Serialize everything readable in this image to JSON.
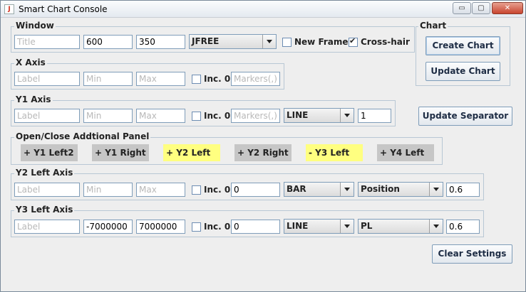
{
  "app": {
    "title": "Smart Chart Console"
  },
  "window_controls": {
    "minimize": "▭",
    "maximize": "▢",
    "close": "✕"
  },
  "window_group": {
    "label": "Window",
    "title": {
      "value": "",
      "placeholder": "Title"
    },
    "width": "600",
    "height": "350",
    "renderer": "JFREE",
    "new_frame": {
      "label": "New Frame",
      "checked": false
    },
    "crosshair": {
      "label": "Cross-hair",
      "checked": true
    }
  },
  "chart_group": {
    "label": "Chart",
    "create_label": "Create Chart",
    "update_label": "Update Chart"
  },
  "x_axis": {
    "label": "X Axis",
    "axis_label_placeholder": "Label",
    "min_placeholder": "Min",
    "max_placeholder": "Max",
    "inc0_label": "Inc. 0",
    "markers_placeholder": "Markers(,)"
  },
  "y1_axis": {
    "label": "Y1 Axis",
    "axis_label_placeholder": "Label",
    "min_placeholder": "Min",
    "max_placeholder": "Max",
    "inc0_label": "Inc. 0",
    "markers_placeholder": "Markers(,)",
    "type": "LINE",
    "value": "1"
  },
  "update_separator_label": "Update Separator",
  "panel_group": {
    "label": "Open/Close Addtional Panel",
    "buttons": [
      {
        "label": "+ Y1 Left2"
      },
      {
        "label": "+ Y1 Right"
      },
      {
        "label": "+ Y2 Left"
      },
      {
        "label": "+ Y2 Right"
      },
      {
        "label": "- Y3 Left"
      },
      {
        "label": "+ Y4 Left"
      }
    ]
  },
  "y2_left_axis": {
    "label": "Y2 Left Axis",
    "axis_label_placeholder": "Label",
    "min_placeholder": "Min",
    "max_placeholder": "Max",
    "inc0_label": "Inc. 0",
    "offset": "0",
    "type": "BAR",
    "position": "Position",
    "ratio": "0.6"
  },
  "y3_left_axis": {
    "label": "Y3 Left Axis",
    "axis_label_placeholder": "Label",
    "min": "-7000000",
    "max": "7000000",
    "inc0_label": "Inc. 0",
    "offset": "0",
    "type": "LINE",
    "position": "PL",
    "ratio": "0.6"
  },
  "clear_settings_label": "Clear Settings",
  "colors": {
    "highlight_yellow": "#ffff80",
    "panel_gray": "#c6c6c6",
    "background": "#eeeeee"
  }
}
